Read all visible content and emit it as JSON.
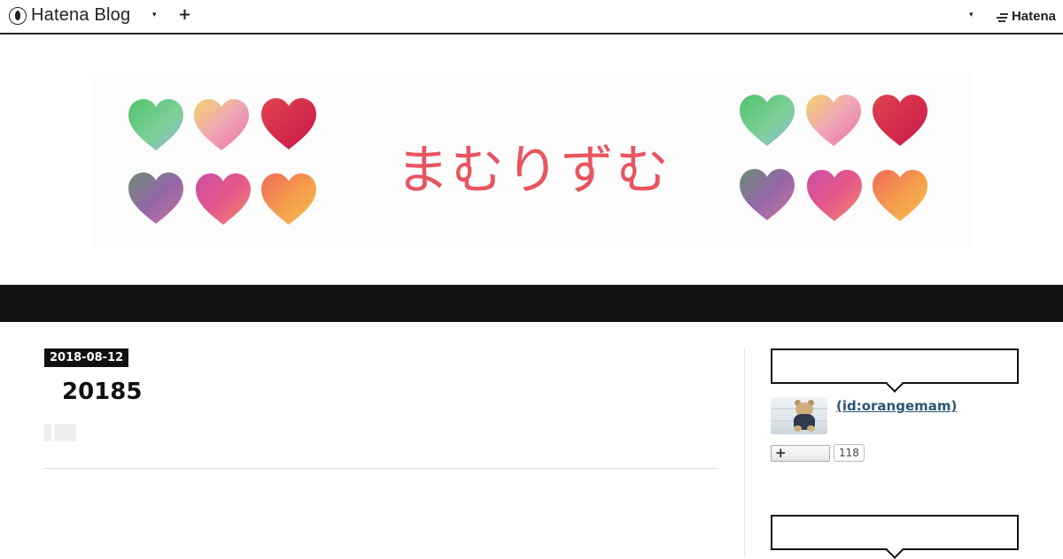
{
  "header": {
    "brand": "Hatena Blog",
    "hatena_link": "Hatena"
  },
  "blog": {
    "title": "まむりずむ"
  },
  "entry": {
    "date": "2018-08-12",
    "title": "20185"
  },
  "sidebar": {
    "profile": {
      "id_link": " (id:orangemam)",
      "readers_count": "118"
    }
  },
  "colors": {
    "title": "#e85560",
    "link": "#2c5577",
    "bar": "#111111"
  },
  "icons": {
    "brand": "hatena-blog-logo-icon",
    "dropdown": "caret-down-icon",
    "add": "plus-icon",
    "hatena": "hatena-logo-icon"
  }
}
